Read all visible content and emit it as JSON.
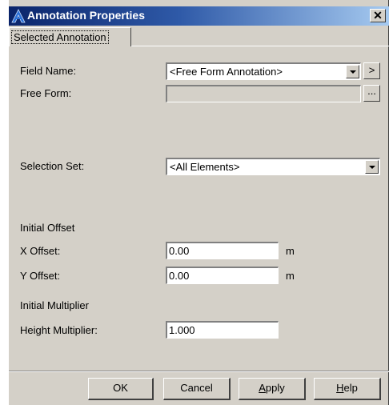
{
  "window": {
    "title": "Annotation Properties",
    "close_label": "✕"
  },
  "tabs": [
    {
      "label": "Selected Annotation"
    }
  ],
  "form": {
    "field_name": {
      "label": "Field Name:",
      "value": "<Free Form Annotation>",
      "more_label": ">"
    },
    "free_form": {
      "label": "Free Form:",
      "value": "",
      "browse_label": "..."
    },
    "selection_set": {
      "label": "Selection Set:",
      "value": "<All Elements>"
    },
    "initial_offset": {
      "heading": "Initial Offset"
    },
    "x_offset": {
      "label": "X Offset:",
      "value": "0.00",
      "unit": "m"
    },
    "y_offset": {
      "label": "Y Offset:",
      "value": "0.00",
      "unit": "m"
    },
    "initial_multiplier": {
      "heading": "Initial Multiplier"
    },
    "height_multiplier": {
      "label": "Height Multiplier:",
      "value": "1.000"
    }
  },
  "buttons": {
    "ok": "OK",
    "cancel": "Cancel",
    "apply": {
      "mnemonic": "A",
      "rest": "pply"
    },
    "help": {
      "mnemonic": "H",
      "rest": "elp"
    }
  },
  "icons": {
    "app": "app-logo-icon",
    "close": "close-icon",
    "dropdown": "chevron-down-icon"
  },
  "colors": {
    "title_start": "#0a246a",
    "title_end": "#a6caf0",
    "face": "#d4d0c8"
  }
}
